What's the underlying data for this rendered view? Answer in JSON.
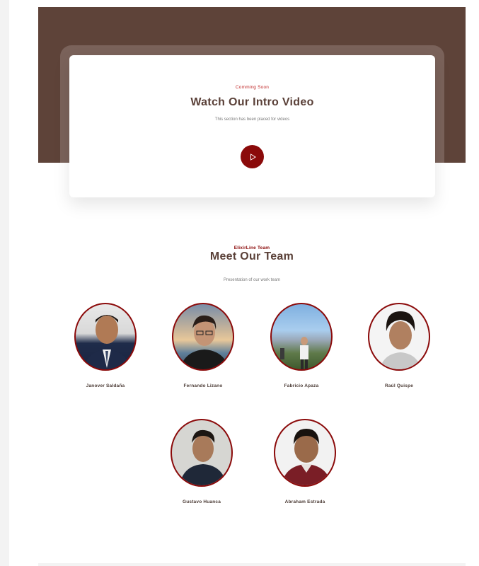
{
  "video": {
    "subtitle": "Comming Soon",
    "title": "Watch Our Intro Video",
    "description": "This section has been placed for videos",
    "play_icon": "play-icon"
  },
  "team": {
    "subtitle": "ElixirLine Team",
    "title": "Meet Our Team",
    "description": "Presentation of our work team",
    "members": [
      {
        "name": "Janover Saldaña"
      },
      {
        "name": "Fernando Lizano"
      },
      {
        "name": "Fabricio Apaza"
      },
      {
        "name": "Raúl Quispe"
      },
      {
        "name": "Gustavo Huanca"
      },
      {
        "name": "Abraham Estrada"
      }
    ]
  },
  "colors": {
    "brown": "#5e4339",
    "accent": "#8b0a0a",
    "heading": "#5a4038"
  }
}
